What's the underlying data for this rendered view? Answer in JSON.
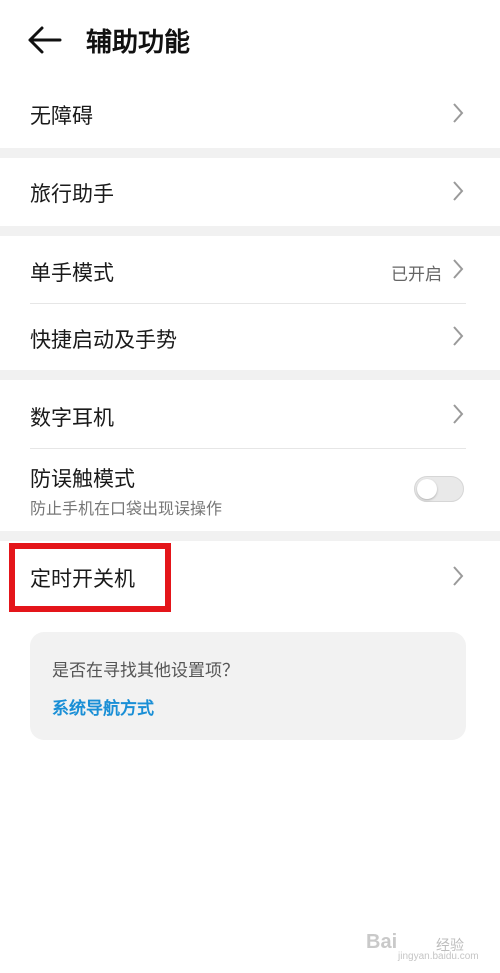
{
  "header": {
    "title": "辅助功能"
  },
  "rows": {
    "accessibility": {
      "label": "无障碍"
    },
    "travel": {
      "label": "旅行助手"
    },
    "one_hand": {
      "label": "单手模式",
      "status": "已开启"
    },
    "shortcuts": {
      "label": "快捷启动及手势"
    },
    "digital_earphone": {
      "label": "数字耳机"
    },
    "mistouch": {
      "label": "防误触模式",
      "subtitle": "防止手机在口袋出现误操作",
      "enabled": false
    },
    "scheduled_power": {
      "label": "定时开关机"
    }
  },
  "card": {
    "question": "是否在寻找其他设置项？",
    "link": "系统导航方式"
  },
  "watermark": {
    "brand": "Bai",
    "brand_cn": "经验",
    "url": "jingyan.baidu.com"
  },
  "colors": {
    "highlight": "#e4151a",
    "link": "#1a8fd6",
    "separator": "#f1f1f1"
  }
}
